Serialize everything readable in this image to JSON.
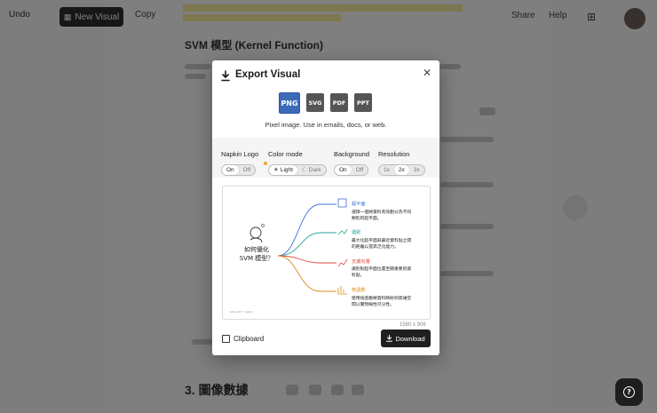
{
  "topbar": {
    "undo_label": "Undo",
    "new_visual_label": "New Visual",
    "copy_label": "Copy",
    "share_label": "Share",
    "help_label": "Help"
  },
  "background": {
    "doc_title": "SVM 模型 (Kernel Function)",
    "section_title": "3. 圖像數據"
  },
  "modal": {
    "title": "Export Visual",
    "formats": [
      {
        "label": "PNG",
        "active": true
      },
      {
        "label": "SVG",
        "active": false
      },
      {
        "label": "PDF",
        "active": false
      },
      {
        "label": "PPT",
        "active": false
      }
    ],
    "format_description": "Pixel image. Use in emails, docs, or web.",
    "options": {
      "napkin_logo": {
        "label": "Napkin Logo",
        "choices": [
          "On",
          "Off"
        ],
        "selected": "On"
      },
      "color_mode": {
        "label": "Color mode",
        "choices": [
          "Light",
          "Dark"
        ],
        "selected": "Light"
      },
      "background": {
        "label": "Background",
        "choices": [
          "On",
          "Off"
        ],
        "selected": "On"
      },
      "resolution": {
        "label": "Resolution",
        "choices": [
          "1x",
          "2x",
          "3x"
        ],
        "selected": "2x"
      }
    },
    "dimensions": "1560 x 906",
    "clipboard_label": "Clipboard",
    "download_label": "Download"
  },
  "preview": {
    "center_title_line1": "如何優化",
    "center_title_line2": "SVM 模型？",
    "footer": "made with ✎ napkin",
    "branches": [
      {
        "title": "超平面",
        "desc_line1": "選擇一個將資料有效劃分為不同",
        "desc_line2": "類別的超平面。",
        "color": "#3d6fd8"
      },
      {
        "title": "邊距",
        "desc_line1": "最大化超平面與最近資料點之間",
        "desc_line2": "的距離以提高泛化能力。",
        "color": "#2aa59a"
      },
      {
        "title": "支援向量",
        "desc_line1": "識別對超平面位置至關重要的資",
        "desc_line2": "料點。",
        "color": "#e0453a"
      },
      {
        "title": "核函數",
        "desc_line1": "使用核函數將資料映射到高維空",
        "desc_line2": "間以實現線性可分性。",
        "color": "#d98a1c"
      }
    ]
  },
  "colors": {
    "accent": "#3d6ab8",
    "download_bg": "#1f1f1f",
    "overlay": "rgba(0,0,0,0.5)"
  }
}
